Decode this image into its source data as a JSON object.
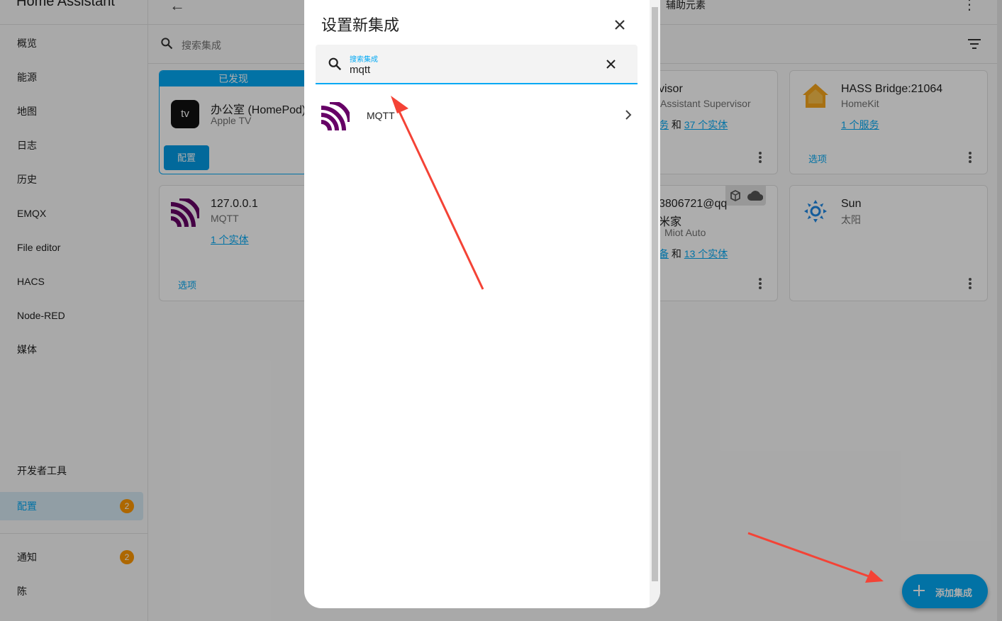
{
  "app": {
    "title": "Home Assistant"
  },
  "sidebar": {
    "items": [
      {
        "label": "概览"
      },
      {
        "label": "能源"
      },
      {
        "label": "地图"
      },
      {
        "label": "日志"
      },
      {
        "label": "历史"
      },
      {
        "label": "EMQX"
      },
      {
        "label": "File editor"
      },
      {
        "label": "HACS"
      },
      {
        "label": "Node-RED"
      },
      {
        "label": "媒体"
      }
    ],
    "dev_tools": "开发者工具",
    "config": {
      "label": "配置",
      "badge": "2"
    },
    "notifications": {
      "label": "通知",
      "badge": "2"
    },
    "user": "陈"
  },
  "topbar": {
    "tab_label": "辅助元素"
  },
  "search": {
    "placeholder": "搜索集成"
  },
  "cards": {
    "discovered": {
      "header": "已发现",
      "title": "办公室 (HomePod)",
      "subtitle": "Apple TV",
      "button": "配置",
      "icon": "apple-tv-icon"
    },
    "mqtt": {
      "title": "127.0.0.1",
      "subtitle": "MQTT",
      "link": "1 个实体",
      "options": "选项"
    },
    "supervisor": {
      "title": "visor",
      "subtitle": "Assistant Supervisor",
      "link_prefix": "务",
      "link_joiner": "和",
      "link2": "37 个实体"
    },
    "hass_bridge": {
      "title": "HASS Bridge:21064",
      "subtitle": "HomeKit",
      "link": "1 个服务",
      "options": "选项"
    },
    "xiaomi": {
      "title": "3806721@qq",
      "title2": "米家",
      "subtitle": "Miot Auto",
      "link_prefix": "备",
      "link_joiner": "和",
      "link2": "13 个实体"
    },
    "sun": {
      "title": "Sun",
      "subtitle": "太阳"
    }
  },
  "dialog": {
    "title": "设置新集成",
    "search_label": "搜索集成",
    "search_value": "mqtt",
    "results": [
      {
        "label": "MQTT"
      }
    ]
  },
  "fab": {
    "label": "添加集成"
  },
  "colors": {
    "accent": "#03a9f4",
    "badge": "#ff9800",
    "mqtt": "#660066",
    "arrow": "#f44336"
  }
}
